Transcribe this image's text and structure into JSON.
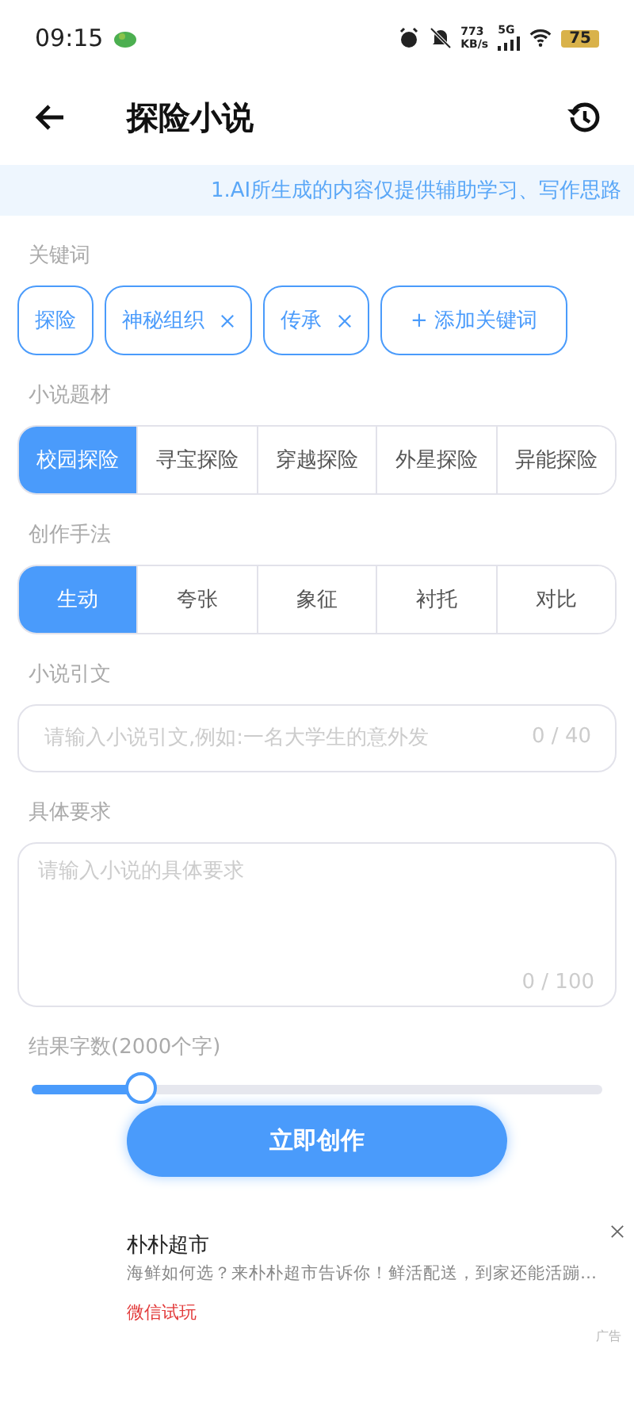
{
  "status_bar": {
    "time": "09:15",
    "speed": "773",
    "speed_unit": "KB/s",
    "network": "5G",
    "battery": "75"
  },
  "header": {
    "title": "探险小说"
  },
  "notice": "1.AI所生成的内容仅提供辅助学习、写作思路",
  "keywords": {
    "label": "关键词",
    "items": [
      {
        "text": "探险",
        "removable": false
      },
      {
        "text": "神秘组织",
        "removable": true
      },
      {
        "text": "传承",
        "removable": true
      }
    ],
    "add": "+ 添加关键词"
  },
  "genre": {
    "label": "小说题材",
    "options": [
      {
        "text": "校园探险",
        "selected": true
      },
      {
        "text": "寻宝探险",
        "selected": false
      },
      {
        "text": "穿越探险",
        "selected": false
      },
      {
        "text": "外星探险",
        "selected": false
      },
      {
        "text": "异能探险",
        "selected": false
      }
    ]
  },
  "technique": {
    "label": "创作手法",
    "options": [
      {
        "text": "生动",
        "selected": true
      },
      {
        "text": "夸张",
        "selected": false
      },
      {
        "text": "象征",
        "selected": false
      },
      {
        "text": "衬托",
        "selected": false
      },
      {
        "text": "对比",
        "selected": false
      }
    ]
  },
  "quote": {
    "label": "小说引文",
    "placeholder": "请输入小说引文,例如:一名大学生的意外发",
    "counter": "0 / 40"
  },
  "requirement": {
    "label": "具体要求",
    "placeholder": "请输入小说的具体要求",
    "counter": "0 / 100"
  },
  "length": {
    "label": "结果字数(2000个字)",
    "level": 0.19
  },
  "submit": "立即创作",
  "ad": {
    "title": "朴朴超市",
    "description": "海鲜如何选？来朴朴超市告诉你！鲜活配送，到家还能活蹦…",
    "action": "微信试玩",
    "tag": "广告"
  }
}
